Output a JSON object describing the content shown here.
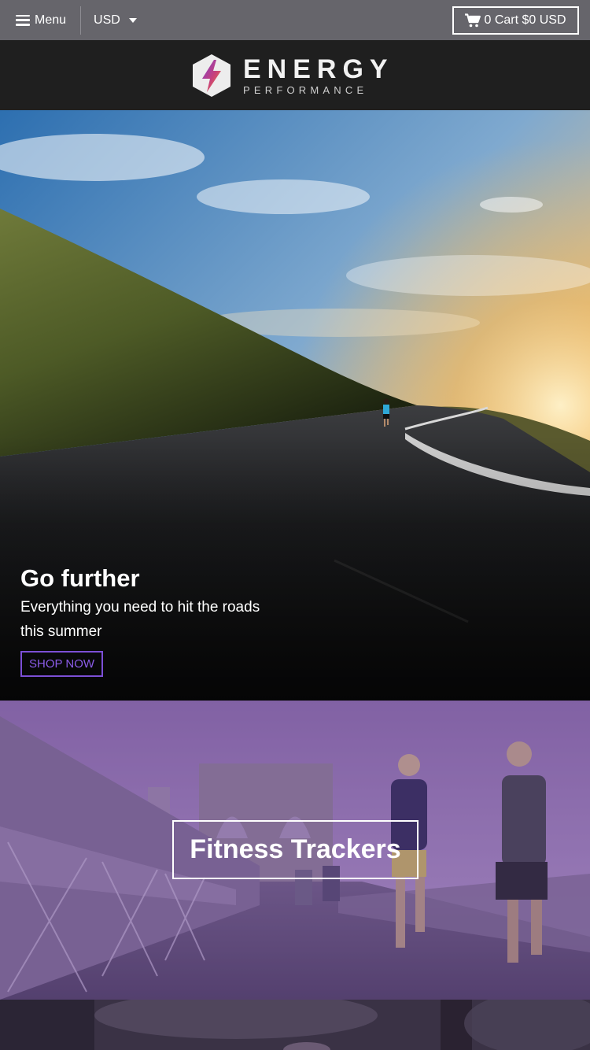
{
  "topbar": {
    "menu_label": "Menu",
    "currency": "USD",
    "cart_label": "0 Cart $0 USD"
  },
  "brand": {
    "name": "ENERGY",
    "tagline": "PERFORMANCE"
  },
  "hero": {
    "title": "Go further",
    "subtitle": "Everything you need to hit the roads this summer",
    "cta_label": "SHOP NOW",
    "cta_color": "#7c4fd6"
  },
  "collection_banner": {
    "label": "Fitness Trackers",
    "overlay_color": "#6b4a9a"
  },
  "icons": [
    "hamburger-icon",
    "chevron-down-icon",
    "cart-icon",
    "energy-logo-icon"
  ]
}
